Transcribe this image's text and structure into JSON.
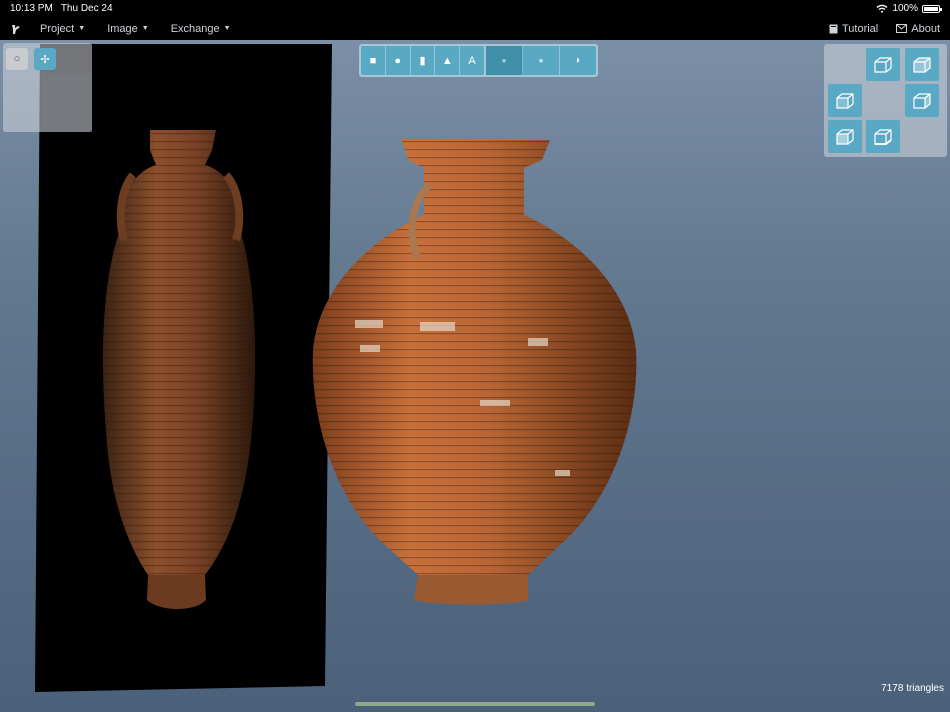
{
  "status_bar": {
    "time": "10:13 PM",
    "date": "Thu Dec 24",
    "battery": "100%",
    "battery_level": 1.0
  },
  "menu": {
    "items": [
      {
        "label": "Project"
      },
      {
        "label": "Image"
      },
      {
        "label": "Exchange"
      }
    ],
    "right": [
      {
        "label": "Tutorial",
        "icon": "book-icon"
      },
      {
        "label": "About",
        "icon": "mail-icon"
      }
    ]
  },
  "tool_panel": {
    "buttons": [
      {
        "glyph": "○",
        "icon": "circle-tool-icon"
      },
      {
        "glyph": "✢",
        "icon": "move-tool-icon"
      }
    ]
  },
  "shape_toolbar": {
    "shapes": [
      {
        "glyph": "■",
        "icon": "square-icon"
      },
      {
        "glyph": "●",
        "icon": "sphere-icon"
      },
      {
        "glyph": "▮",
        "icon": "cylinder-icon"
      },
      {
        "glyph": "▲",
        "icon": "cone-icon"
      },
      {
        "glyph": "A",
        "icon": "text-icon"
      }
    ],
    "modes": [
      {
        "glyph": "●",
        "icon": "solid-shading-icon"
      },
      {
        "glyph": "●",
        "icon": "smooth-shading-icon"
      },
      {
        "glyph": "◗",
        "icon": "half-shading-icon"
      }
    ]
  },
  "view_panel": {
    "views": [
      "view-top-icon",
      "view-top-right-icon",
      "view-left-icon",
      "view-right-icon",
      "view-front-icon",
      "view-bottom-icon"
    ]
  },
  "viewport": {
    "triangles": "7178 triangles"
  },
  "colors": {
    "accent": "#5aa9c4",
    "menu_bg": "#000000"
  }
}
